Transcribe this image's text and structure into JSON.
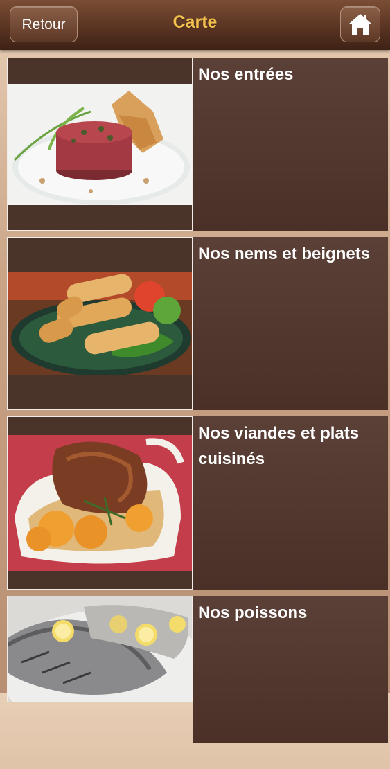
{
  "header": {
    "title": "Carte",
    "back_label": "Retour",
    "home_icon": "home-icon"
  },
  "menu": {
    "items": [
      {
        "label": "Nos entrées",
        "image": "steak-tartare-image"
      },
      {
        "label": "Nos nems et beignets",
        "image": "spring-rolls-image"
      },
      {
        "label": "Nos viandes et plats cuisinés",
        "image": "roast-chicken-dish-image"
      },
      {
        "label": "Nos poissons",
        "image": "grilled-fish-image"
      }
    ]
  },
  "colors": {
    "header_title": "#f2c14e",
    "header_bg": "#5a3422",
    "panel_bg": "#4e352b"
  }
}
